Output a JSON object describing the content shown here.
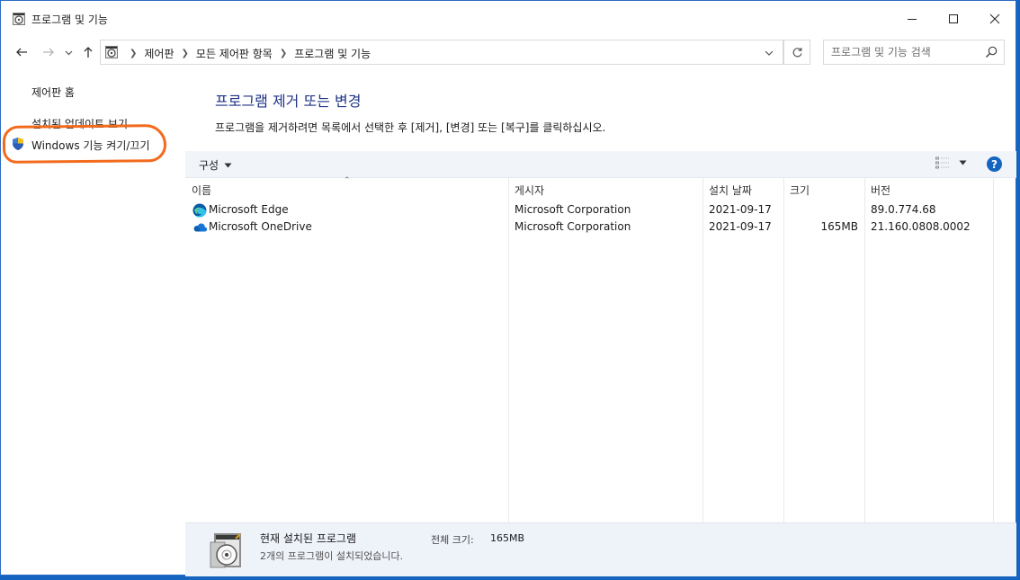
{
  "window": {
    "title": "프로그램 및 기능"
  },
  "address": {
    "crumbs": [
      "제어판",
      "모든 제어판 항목",
      "프로그램 및 기능"
    ]
  },
  "search": {
    "placeholder": "프로그램 및 기능 검색"
  },
  "sidebar": {
    "items": [
      {
        "label": "제어판 홈"
      },
      {
        "label": "설치된 업데이트 보기"
      },
      {
        "label": "Windows 기능 켜기/끄기",
        "icon": "shield-icon",
        "highlighted": true
      }
    ],
    "highlight_color": "#f26b1d"
  },
  "main": {
    "title": "프로그램 제거 또는 변경",
    "description": "프로그램을 제거하려면 목록에서 선택한 후 [제거], [변경] 또는 [복구]를 클릭하십시오.",
    "title_color": "#1e3287"
  },
  "toolbar": {
    "organize_label": "구성",
    "help_label": "?"
  },
  "table": {
    "columns": [
      "이름",
      "게시자",
      "설치 날짜",
      "크기",
      "버전"
    ],
    "rows": [
      {
        "name": "Microsoft Edge",
        "icon": "edge-icon",
        "publisher": "Microsoft Corporation",
        "installed": "2021-09-17",
        "size": "",
        "version": "89.0.774.68"
      },
      {
        "name": "Microsoft OneDrive",
        "icon": "onedrive-icon",
        "publisher": "Microsoft Corporation",
        "installed": "2021-09-17",
        "size": "165MB",
        "version": "21.160.0808.0002"
      }
    ]
  },
  "details": {
    "title": "현재 설치된 프로그램",
    "total_label": "전체 크기:",
    "total_value": "165MB",
    "count_text": "2개의 프로그램이 설치되었습니다."
  }
}
